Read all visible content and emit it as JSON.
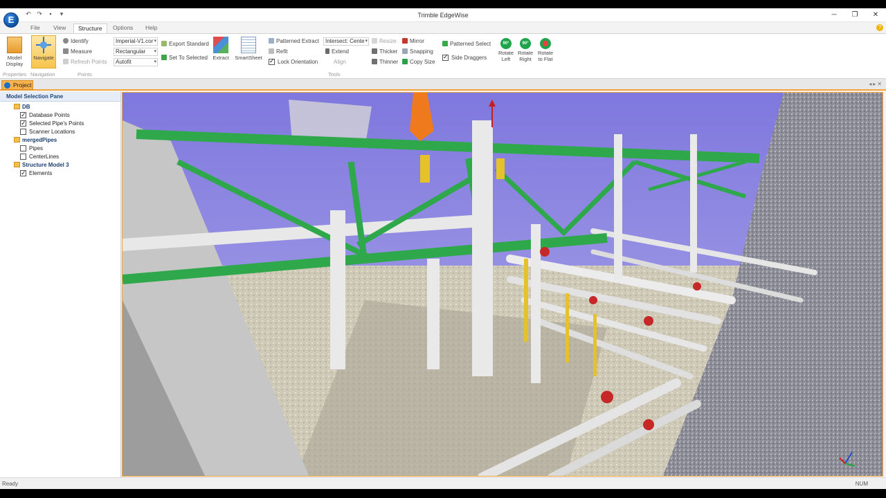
{
  "app": {
    "title": "Trimble EdgeWise",
    "logo_letter": "E"
  },
  "window_controls": {
    "minimize": "─",
    "restore": "❐",
    "close": "✕"
  },
  "menu": {
    "tabs": [
      {
        "label": "File"
      },
      {
        "label": "View"
      },
      {
        "label": "Structure"
      },
      {
        "label": "Options"
      },
      {
        "label": "Help"
      }
    ],
    "active": "Structure"
  },
  "ribbon": {
    "model_display": "Model Display",
    "navigate": "Navigate",
    "identify": "Identify",
    "measure": "Measure",
    "refresh_points": "Refresh Points",
    "units_combo": "Imperial-V1.cor",
    "shape_combo": "Rectangular",
    "fit_combo": "Autofit",
    "export_standard": "Export Standard",
    "set_to_selected": "Set To Selected",
    "extract": "Extract",
    "smartsheet": "SmartSheet",
    "patterned_extract": "Patterned Extract",
    "refit": "Refit",
    "lock_orientation": "Lock Orientation",
    "intersect_combo": "Intersect: Cente",
    "extend": "Extend",
    "resize": "Resize",
    "thicker": "Thicker",
    "thinner": "Thinner",
    "align": "Align",
    "mirror": "Mirror",
    "snapping": "Snapping",
    "copy_size": "Copy Size",
    "patterned_select": "Patterned Select",
    "side_draggers": "Side Draggers",
    "rotate_left": "Rotate Left",
    "rotate_right": "Rotate Right",
    "rotate_to_flat": "Rotate to Flat",
    "rotate_left_angle": "90°",
    "rotate_right_angle": "90°",
    "group_properties": "Properties",
    "group_navigation": "Navigation",
    "group_points": "Points",
    "group_tools": "Tools"
  },
  "project_tab": {
    "label": "Project"
  },
  "model_selection_pane": {
    "title": "Model Selection Pane",
    "tree": [
      {
        "label": "DB",
        "type": "group"
      },
      {
        "label": "Database Points",
        "checked": true
      },
      {
        "label": "Selected Pipe's Points",
        "checked": true
      },
      {
        "label": "Scanner Locations",
        "checked": false
      },
      {
        "label": "mergedPipes",
        "type": "group"
      },
      {
        "label": "Pipes",
        "checked": false
      },
      {
        "label": "CenterLines",
        "checked": false
      },
      {
        "label": "Structure Model 3",
        "type": "group"
      },
      {
        "label": "Elements",
        "checked": true
      }
    ]
  },
  "viewport": {
    "description_icon": "point-cloud-view",
    "sky_color": "#8f87e0",
    "steel_color": "#2ea84a"
  },
  "status": {
    "left": "Ready",
    "right": "NUM"
  }
}
